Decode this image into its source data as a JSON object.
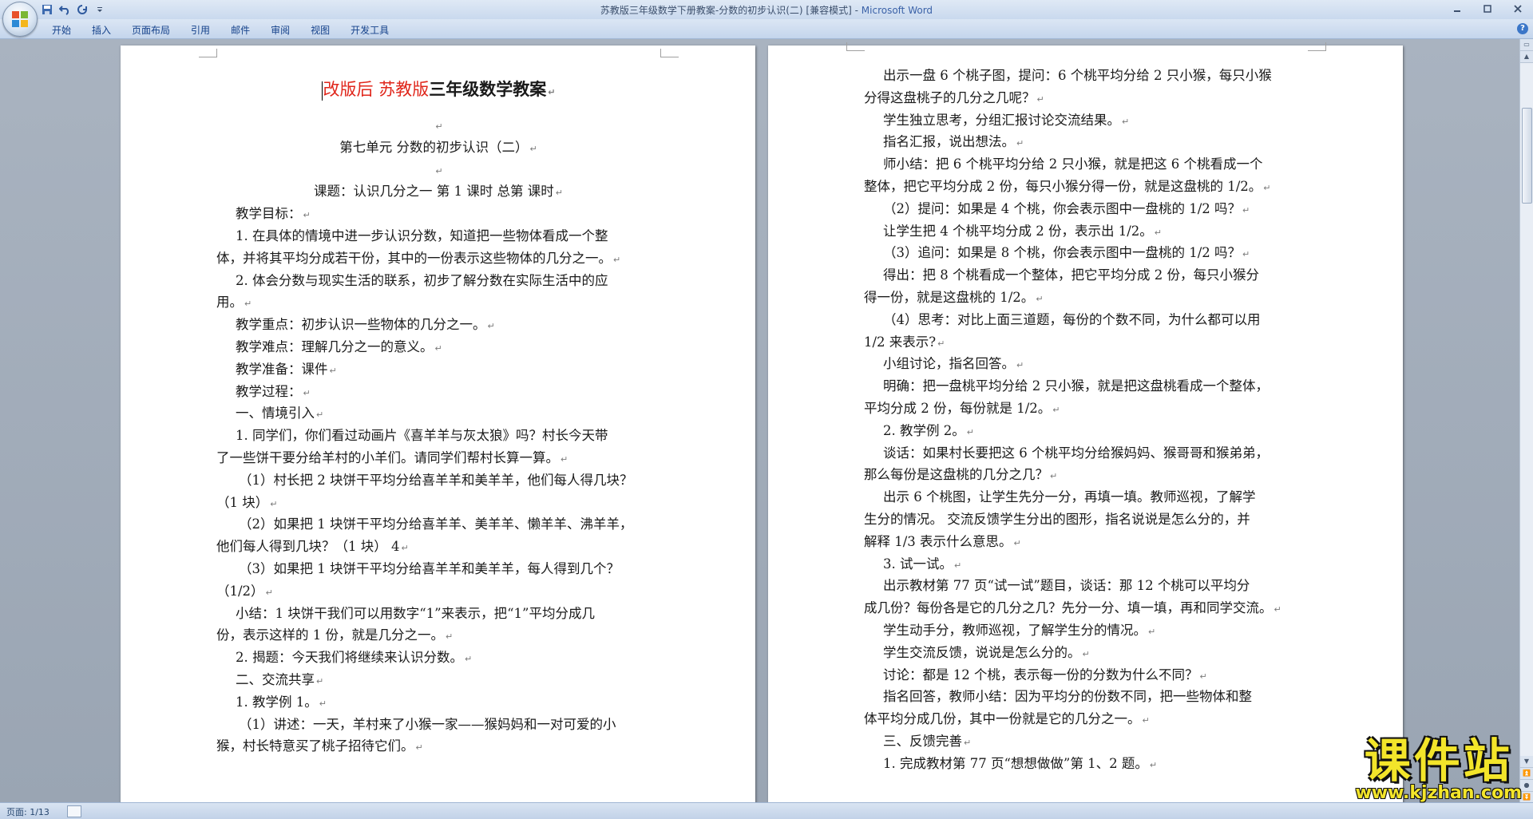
{
  "window": {
    "title": "苏教版三年级数学下册教案-分数的初步认识(二) [兼容模式]",
    "app_name": "Microsoft Word",
    "controls": [
      "minimize",
      "maximize",
      "close"
    ]
  },
  "quick_access": [
    "save-icon",
    "undo-icon",
    "redo-icon",
    "customize-icon"
  ],
  "ribbon": {
    "tabs": [
      "开始",
      "插入",
      "页面布局",
      "引用",
      "邮件",
      "审阅",
      "视图",
      "开发工具"
    ],
    "help": "?"
  },
  "page1": {
    "heading_red": "改版后  苏教版",
    "heading_black": "三年级数学教案",
    "lines": [
      {
        "t": "",
        "c": 1
      },
      {
        "t": "第七单元  分数的初步认识（二）",
        "c": 1
      },
      {
        "t": "",
        "c": 1
      },
      {
        "t": "课题：认识几分之一  第  1  课时  总第  课时",
        "c": 1
      },
      {
        "t": "教学目标：",
        "i": 1
      },
      {
        "t": "1. 在具体的情境中进一步认识分数，知道把一些物体看成一个整",
        "i": 1,
        "nm": 1
      },
      {
        "t": "体，并将其平均分成若干份，其中的一份表示这些物体的几分之一。"
      },
      {
        "t": "2. 体会分数与现实生活的联系，初步了解分数在实际生活中的应",
        "i": 1,
        "nm": 1
      },
      {
        "t": "用。"
      },
      {
        "t": "教学重点：初步认识一些物体的几分之一。",
        "i": 1
      },
      {
        "t": "教学难点：理解几分之一的意义。",
        "i": 1
      },
      {
        "t": "教学准备：课件",
        "i": 1
      },
      {
        "t": "教学过程：",
        "i": 1
      },
      {
        "t": "一、情境引入",
        "i": 1
      },
      {
        "t": "1. 同学们，你们看过动画片《喜羊羊与灰太狼》吗？村长今天带",
        "i": 1,
        "nm": 1
      },
      {
        "t": "了一些饼干要分给羊村的小羊们。请同学们帮村长算一算。"
      },
      {
        "t": "（1）村长把 2 块饼干平均分给喜羊羊和美羊羊，他们每人得几块？",
        "i": 2,
        "nm": 1
      },
      {
        "t": "（1 块）"
      },
      {
        "t": "（2）如果把 1 块饼干平均分给喜羊羊、美羊羊、懒羊羊、沸羊羊，",
        "i": 2,
        "nm": 1
      },
      {
        "t": "他们每人得到几块？（1 块） 4"
      },
      {
        "t": "（3）如果把 1 块饼干平均分给喜羊羊和美羊羊，每人得到几个？",
        "i": 2,
        "nm": 1
      },
      {
        "t": "（1/2）"
      },
      {
        "t": "小结：1 块饼干我们可以用数字“1”来表示，把“1”平均分成几",
        "i": 1,
        "nm": 1
      },
      {
        "t": "份，表示这样的 1 份，就是几分之一。"
      },
      {
        "t": "2. 揭题：今天我们将继续来认识分数。",
        "i": 1
      },
      {
        "t": "二、交流共享",
        "i": 1
      },
      {
        "t": "1. 教学例 1。",
        "i": 1
      },
      {
        "t": "（1）讲述：一天，羊村来了小猴一家——猴妈妈和一对可爱的小",
        "i": 2,
        "nm": 1
      },
      {
        "t": "猴，村长特意买了桃子招待它们。"
      }
    ]
  },
  "page2": {
    "lines": [
      {
        "t": "出示一盘 6 个桃子图，提问：6 个桃平均分给 2 只小猴，每只小猴",
        "i": 1,
        "nm": 1
      },
      {
        "t": "分得这盘桃子的几分之几呢？"
      },
      {
        "t": "学生独立思考，分组汇报讨论交流结果。",
        "i": 1
      },
      {
        "t": "指名汇报，说出想法。",
        "i": 1
      },
      {
        "t": "师小结：把 6 个桃平均分给 2 只小猴，就是把这 6 个桃看成一个",
        "i": 1,
        "nm": 1
      },
      {
        "t": "整体，把它平均分成 2 份，每只小猴分得一份，就是这盘桃的 1/2。"
      },
      {
        "t": "（2）提问：如果是 4 个桃，你会表示图中一盘桃的 1/2 吗？",
        "i": 1
      },
      {
        "t": "让学生把 4 个桃平均分成 2 份，表示出 1/2。",
        "i": 1
      },
      {
        "t": "（3）追问：如果是 8 个桃，你会表示图中一盘桃的 1/2 吗？",
        "i": 1
      },
      {
        "t": "得出：把 8 个桃看成一个整体，把它平均分成 2 份，每只小猴分",
        "i": 1,
        "nm": 1
      },
      {
        "t": "得一份，就是这盘桃的 1/2。"
      },
      {
        "t": "（4）思考：对比上面三道题，每份的个数不同，为什么都可以用",
        "i": 1,
        "nm": 1
      },
      {
        "t": "1/2 来表示?"
      },
      {
        "t": "小组讨论，指名回答。",
        "i": 1
      },
      {
        "t": "明确：把一盘桃平均分给 2 只小猴，就是把这盘桃看成一个整体，",
        "i": 1,
        "nm": 1
      },
      {
        "t": "平均分成 2 份，每份就是 1/2。"
      },
      {
        "t": "2. 教学例 2。",
        "i": 1
      },
      {
        "t": "谈话：如果村长要把这 6 个桃平均分给猴妈妈、猴哥哥和猴弟弟，",
        "i": 1,
        "nm": 1
      },
      {
        "t": "那么每份是这盘桃的几分之几？"
      },
      {
        "t": "出示 6 个桃图，让学生先分一分，再填一填。教师巡视，了解学",
        "i": 1,
        "nm": 1
      },
      {
        "t": "生分的情况。 交流反馈学生分出的图形，指名说说是怎么分的，并",
        "nm": 1
      },
      {
        "t": "解释 1/3 表示什么意思。"
      },
      {
        "t": "3. 试一试。",
        "i": 1
      },
      {
        "t": "出示教材第 77 页“试一试”题目，谈话：那 12 个桃可以平均分",
        "i": 1,
        "nm": 1
      },
      {
        "t": "成几份？每份各是它的几分之几？先分一分、填一填，再和同学交流。"
      },
      {
        "t": "学生动手分，教师巡视，了解学生分的情况。",
        "i": 1
      },
      {
        "t": "学生交流反馈，说说是怎么分的。",
        "i": 1
      },
      {
        "t": "讨论：都是 12 个桃，表示每一份的分数为什么不同？",
        "i": 1
      },
      {
        "t": "指名回答，教师小结：因为平均分的份数不同，把一些物体和整",
        "i": 1,
        "nm": 1
      },
      {
        "t": "体平均分成几份，其中一份就是它的几分之一。"
      },
      {
        "t": "三、反馈完善",
        "i": 1
      },
      {
        "t": "1. 完成教材第 77 页“想想做做”第 1、2 题。",
        "i": 1
      }
    ]
  },
  "status": {
    "page": "页面: 1/13"
  },
  "watermark": {
    "title": "课件站",
    "url": "www.kjzhan.com"
  },
  "colors": {
    "ribbon": "#c4d5ec",
    "tab_text": "#15428b",
    "heading_red": "#e0261b",
    "watermark": "#f3e52a"
  }
}
